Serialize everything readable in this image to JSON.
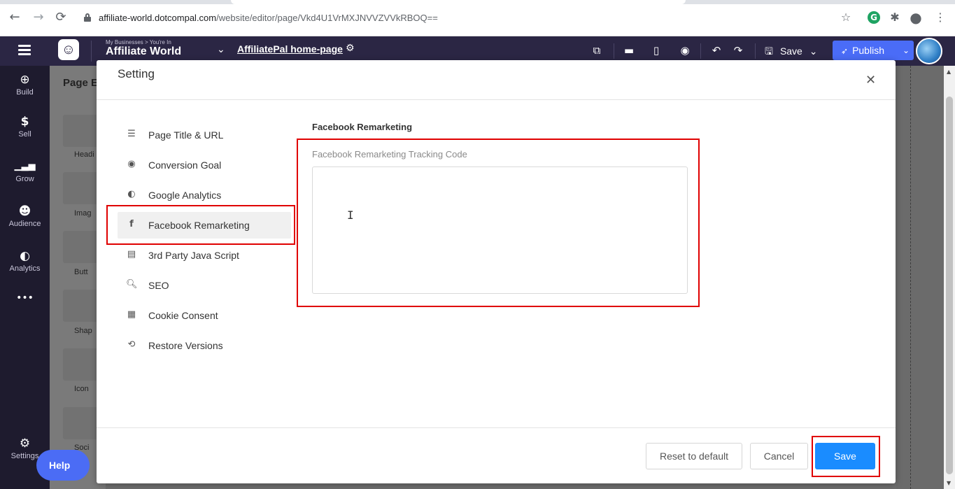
{
  "browser": {
    "url_domain": "affiliate-world.dotcompal.com",
    "url_path": "/website/editor/page/Vkd4U1VrMXJNVVZVVkRBOQ==",
    "back_icon": "back-arrow-icon",
    "forward_icon": "forward-arrow-icon",
    "reload_icon": "reload-icon"
  },
  "header": {
    "breadcrumb": "My Businesses > You're In",
    "business_name": "Affiliate World",
    "page_name": "AffiliatePal home-page",
    "save_label": "Save",
    "publish_label": "Publish",
    "publish_color": "#4a6cf7"
  },
  "sidebar": {
    "items": [
      {
        "label": "Build",
        "icon": "plus-circle-icon"
      },
      {
        "label": "Sell",
        "icon": "dollar-icon"
      },
      {
        "label": "Grow",
        "icon": "bars-icon"
      },
      {
        "label": "Audience",
        "icon": "users-icon"
      },
      {
        "label": "Analytics",
        "icon": "analytics-icon"
      },
      {
        "label": "Settings",
        "icon": "gear-icon"
      }
    ]
  },
  "background_panel": {
    "title": "Page E",
    "items": [
      "Headi",
      "Imag",
      "Butt",
      "Shap",
      "Icon",
      "Soci"
    ],
    "help_label": "Help"
  },
  "modal": {
    "title": "Setting",
    "menu": [
      {
        "label": "Page Title & URL",
        "icon": "layout-icon"
      },
      {
        "label": "Conversion Goal",
        "icon": "target-icon"
      },
      {
        "label": "Google Analytics",
        "icon": "analytics-icon"
      },
      {
        "label": "Facebook Remarketing",
        "icon": "facebook-icon",
        "active": true
      },
      {
        "label": "3rd Party Java Script",
        "icon": "script-icon"
      },
      {
        "label": "SEO",
        "icon": "search-icon"
      },
      {
        "label": "Cookie Consent",
        "icon": "cookie-icon"
      },
      {
        "label": "Restore Versions",
        "icon": "restore-icon"
      }
    ],
    "content": {
      "heading": "Facebook Remarketing",
      "field_label": "Facebook Remarketing Tracking Code",
      "field_value": ""
    },
    "footer": {
      "reset_label": "Reset to default",
      "cancel_label": "Cancel",
      "save_label": "Save",
      "save_color": "#1a8cff"
    },
    "highlight_color": "#e00000"
  }
}
